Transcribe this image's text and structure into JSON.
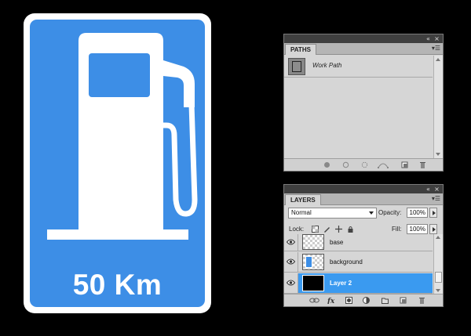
{
  "sign": {
    "text": "50 Km",
    "colors": {
      "background": "#3d8ee6",
      "border": "#ffffff",
      "foreground": "#ffffff"
    },
    "icon": "fuel-pump-icon"
  },
  "paths_panel": {
    "tab_label": "PATHS",
    "items": [
      {
        "label": "Work Path"
      }
    ],
    "footer_icons": [
      "fill-path-icon",
      "stroke-path-icon",
      "load-selection-icon",
      "make-work-path-icon",
      "new-path-icon",
      "delete-path-icon"
    ]
  },
  "layers_panel": {
    "tab_label": "LAYERS",
    "blend_mode": "Normal",
    "opacity_label": "Opacity:",
    "opacity_value": "100%",
    "lock_label": "Lock:",
    "fill_label": "Fill:",
    "fill_value": "100%",
    "layers": [
      {
        "name": "base",
        "thumbnail": "transparent",
        "selected": false
      },
      {
        "name": "background",
        "thumbnail": "blue-sign",
        "selected": false
      },
      {
        "name": "Layer 2",
        "thumbnail": "black",
        "selected": true
      }
    ],
    "footer_icons": [
      "link-icon",
      "fx-icon",
      "mask-icon",
      "adjustment-icon",
      "group-icon",
      "new-layer-icon",
      "delete-layer-icon"
    ],
    "selection_color": "#3a9af0"
  }
}
